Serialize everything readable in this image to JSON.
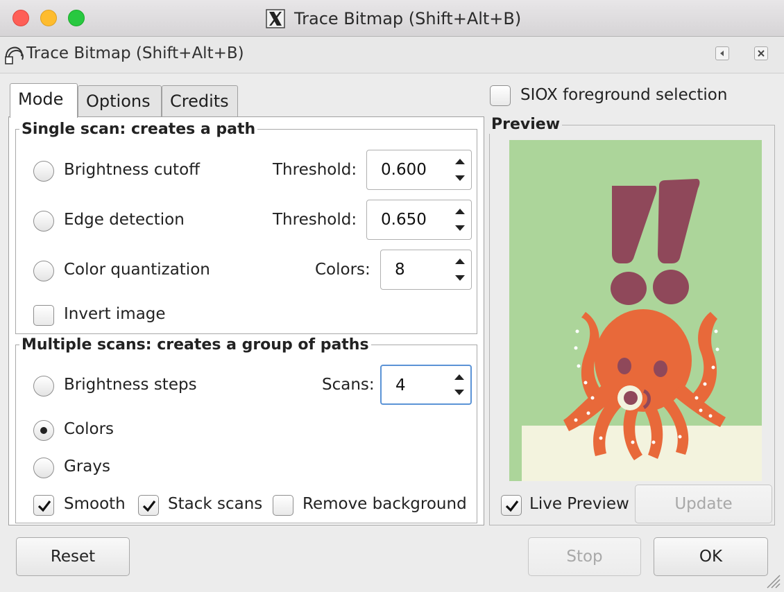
{
  "window": {
    "title": "Trace Bitmap (Shift+Alt+B)",
    "dock_title": "Trace Bitmap (Shift+Alt+B)"
  },
  "tabs": [
    {
      "label": "Mode",
      "active": true
    },
    {
      "label": "Options",
      "active": false
    },
    {
      "label": "Credits",
      "active": false
    }
  ],
  "single_scan": {
    "legend": "Single scan: creates a path",
    "brightness_cutoff": {
      "label": "Brightness cutoff",
      "param_label": "Threshold:",
      "value": "0.600",
      "selected": false
    },
    "edge_detection": {
      "label": "Edge detection",
      "param_label": "Threshold:",
      "value": "0.650",
      "selected": false
    },
    "color_quantization": {
      "label": "Color quantization",
      "param_label": "Colors:",
      "value": "8",
      "selected": false
    },
    "invert_image": {
      "label": "Invert image",
      "checked": false
    }
  },
  "multiple_scans": {
    "legend": "Multiple scans: creates a group of paths",
    "brightness_steps": {
      "label": "Brightness steps",
      "param_label": "Scans:",
      "value": "4",
      "selected": false
    },
    "colors": {
      "label": "Colors",
      "selected": true
    },
    "grays": {
      "label": "Grays",
      "selected": false
    },
    "smooth": {
      "label": "Smooth",
      "checked": true
    },
    "stack_scans": {
      "label": "Stack scans",
      "checked": true
    },
    "remove_background": {
      "label": "Remove background",
      "checked": false
    }
  },
  "siox": {
    "label": "SIOX foreground selection",
    "checked": false
  },
  "preview": {
    "legend": "Preview",
    "live_preview": {
      "label": "Live Preview",
      "checked": true
    },
    "update_label": "Update",
    "colors": {
      "background": "#acd59a",
      "floor": "#f3f3de",
      "octopus": "#e8693a",
      "marks": "#8f485a",
      "spots": "#ffffff"
    }
  },
  "buttons": {
    "reset": "Reset",
    "stop": "Stop",
    "ok": "OK"
  },
  "icons": {
    "app": "x11-icon",
    "dock": "trace-bitmap-icon",
    "dock_controls": [
      "collapse-icon",
      "close-icon"
    ]
  }
}
